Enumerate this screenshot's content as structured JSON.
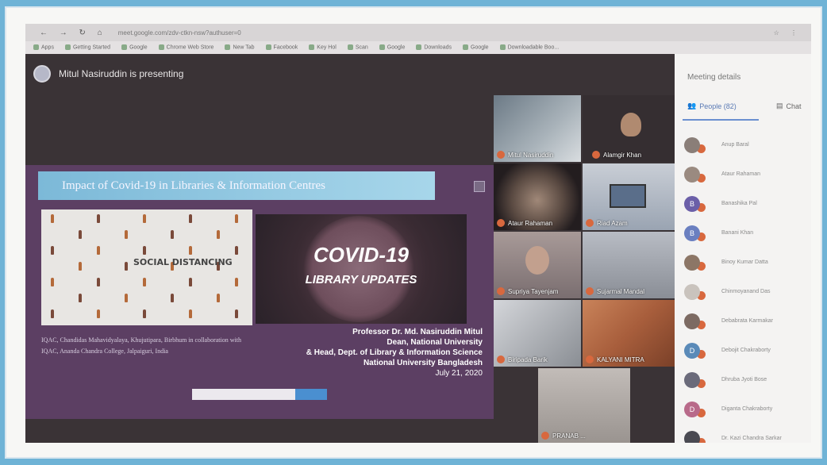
{
  "browser": {
    "url": "meet.google.com/zdv-ctkn-nsw?authuser=0",
    "bookmarks": [
      "Apps",
      "Getting Started",
      "Google",
      "Chrome Web Store",
      "New Tab",
      "Facebook",
      "Key Hol",
      "Scan",
      "Google",
      "Downloads",
      "Google",
      "Downloadable Boo..."
    ]
  },
  "meet": {
    "presenter_label": "Mitul Nasiruddin is presenting"
  },
  "slide": {
    "title": "Impact of Covid-19 in Libraries & Information Centres",
    "social_label": "SOCIAL DISTANCING",
    "covid_title": "COVID-19",
    "covid_subtitle": "LIBRARY UPDATES",
    "iqac_text": "IQAC, Chandidas Mahavidyalaya, Khujutipara, Birbhum in collaboration with IQAC, Ananda Chandra College, Jalpaiguri, India",
    "presenter_name": "Professor Dr. Md. Nasiruddin Mitul",
    "presenter_role": "Dean,  National University",
    "presenter_dept": "& Head, Dept. of Library & Information Science",
    "presenter_org": "National University Bangladesh",
    "date": "July 21, 2020"
  },
  "tiles": [
    {
      "name": "Mitul Nasiruddin"
    },
    {
      "name": "Alamgir Khan"
    },
    {
      "name": "Ataur Rahaman"
    },
    {
      "name": "Riad Azam"
    },
    {
      "name": "Supriya Tayenjam"
    },
    {
      "name": "Sujarmal Mandal"
    },
    {
      "name": "Biripada Barik"
    },
    {
      "name": "KALYANI MITRA"
    },
    {
      "name": "PRANAB ..."
    }
  ],
  "panel": {
    "title": "Meeting details",
    "people_tab": "People (82)",
    "chat_tab": "Chat",
    "people": [
      {
        "initial": "",
        "name": "Anup Baral",
        "color": "#8a7e78"
      },
      {
        "initial": "",
        "name": "Ataur Rahaman",
        "color": "#9a8a80"
      },
      {
        "initial": "B",
        "name": "Banashika Pal",
        "color": "#6b5fa8"
      },
      {
        "initial": "B",
        "name": "Banani Khan",
        "color": "#6a7fc0"
      },
      {
        "initial": "",
        "name": "Binoy Kumar Datta",
        "color": "#8c7666"
      },
      {
        "initial": "",
        "name": "Chinmoyanand Das",
        "color": "#c9c3bd"
      },
      {
        "initial": "",
        "name": "Debabrata Karmakar",
        "color": "#7c6a62"
      },
      {
        "initial": "D",
        "name": "Debojit Chakraborty",
        "color": "#5a8ab8"
      },
      {
        "initial": "",
        "name": "Dhruba Jyoti Bose",
        "color": "#6a6a7a"
      },
      {
        "initial": "D",
        "name": "Diganta Chakraborty",
        "color": "#b86a8a"
      },
      {
        "initial": "",
        "name": "Dr. Kazi Chandra Sarkar",
        "color": "#4a4a52"
      }
    ]
  }
}
